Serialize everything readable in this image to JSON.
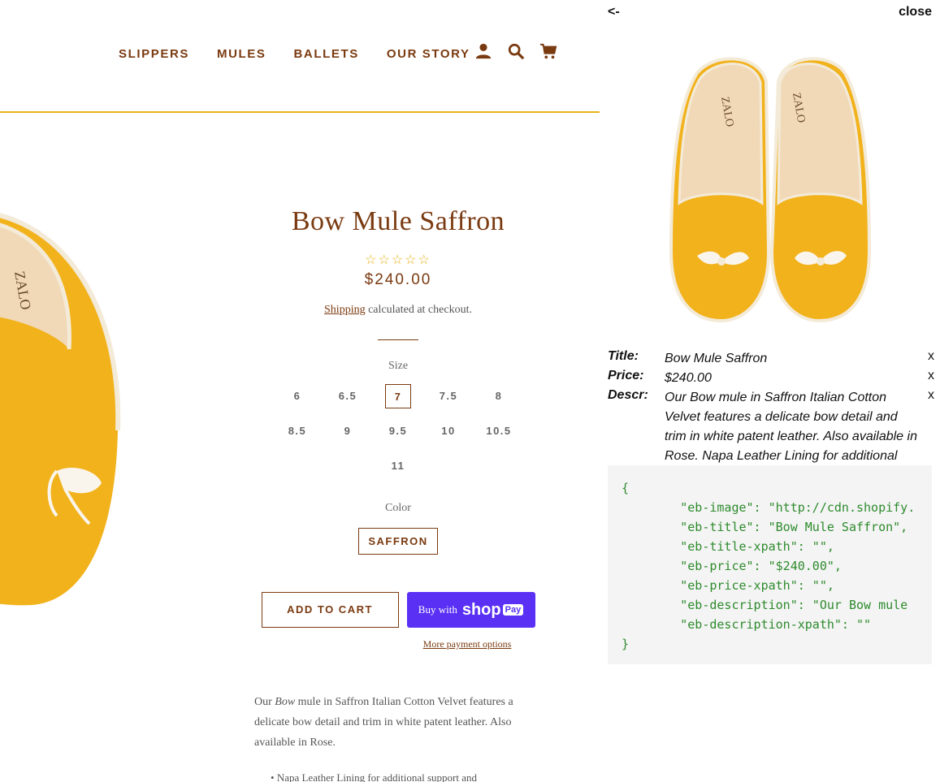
{
  "nav": {
    "links": [
      "SLIPPERS",
      "MULES",
      "BALLETS",
      "OUR STORY"
    ],
    "icons": [
      "user-icon",
      "search-icon",
      "cart-icon"
    ]
  },
  "product": {
    "title": "Bow Mule Saffron",
    "rating": 0,
    "rating_max": 5,
    "price": "$240.00",
    "shipping_link": "Shipping",
    "shipping_text": "calculated at checkout.",
    "size_label": "Size",
    "sizes": [
      "6",
      "6.5",
      "7",
      "7.5",
      "8",
      "8.5",
      "9",
      "9.5",
      "10",
      "10.5",
      "11"
    ],
    "selected_size": "7",
    "color_label": "Color",
    "color": "SAFFRON",
    "add_to_cart": "ADD TO CART",
    "buy_with": "Buy with",
    "shop_pay": "shop",
    "pay_badge": "Pay",
    "more_payment": "More payment options",
    "desc_prefix": "Our",
    "desc_em": "Bow",
    "desc_rest": "mule in Saffron Italian Cotton Velvet features a delicate bow detail and trim in white patent leather. Also available in Rose.",
    "bullet": "Napa Leather Lining for additional support and"
  },
  "panel": {
    "back": "<-",
    "close": "close",
    "fields": [
      {
        "key": "Title:",
        "value": "Bow Mule Saffron",
        "remove": "x"
      },
      {
        "key": "Price:",
        "value": "$240.00",
        "remove": "x"
      },
      {
        "key": "Descr:",
        "value": "Our Bow mule in Saffron Italian Cotton Velvet features a delicate bow detail and trim in white patent leather. Also available in Rose. Napa Leather Lining for additional",
        "remove": "x"
      }
    ],
    "code": "{\n        \"eb-image\": \"http://cdn.shopify.\n        \"eb-title\": \"Bow Mule Saffron\",\n        \"eb-title-xpath\": \"\",\n        \"eb-price\": \"$240.00\",\n        \"eb-price-xpath\": \"\",\n        \"eb-description\": \"Our Bow mule\n        \"eb-description-xpath\": \"\"\n}"
  },
  "colors": {
    "brand": "#7a3a10",
    "accent": "#e8b21a",
    "shop_pay": "#5a31f4",
    "velvet": "#f2b21c"
  }
}
